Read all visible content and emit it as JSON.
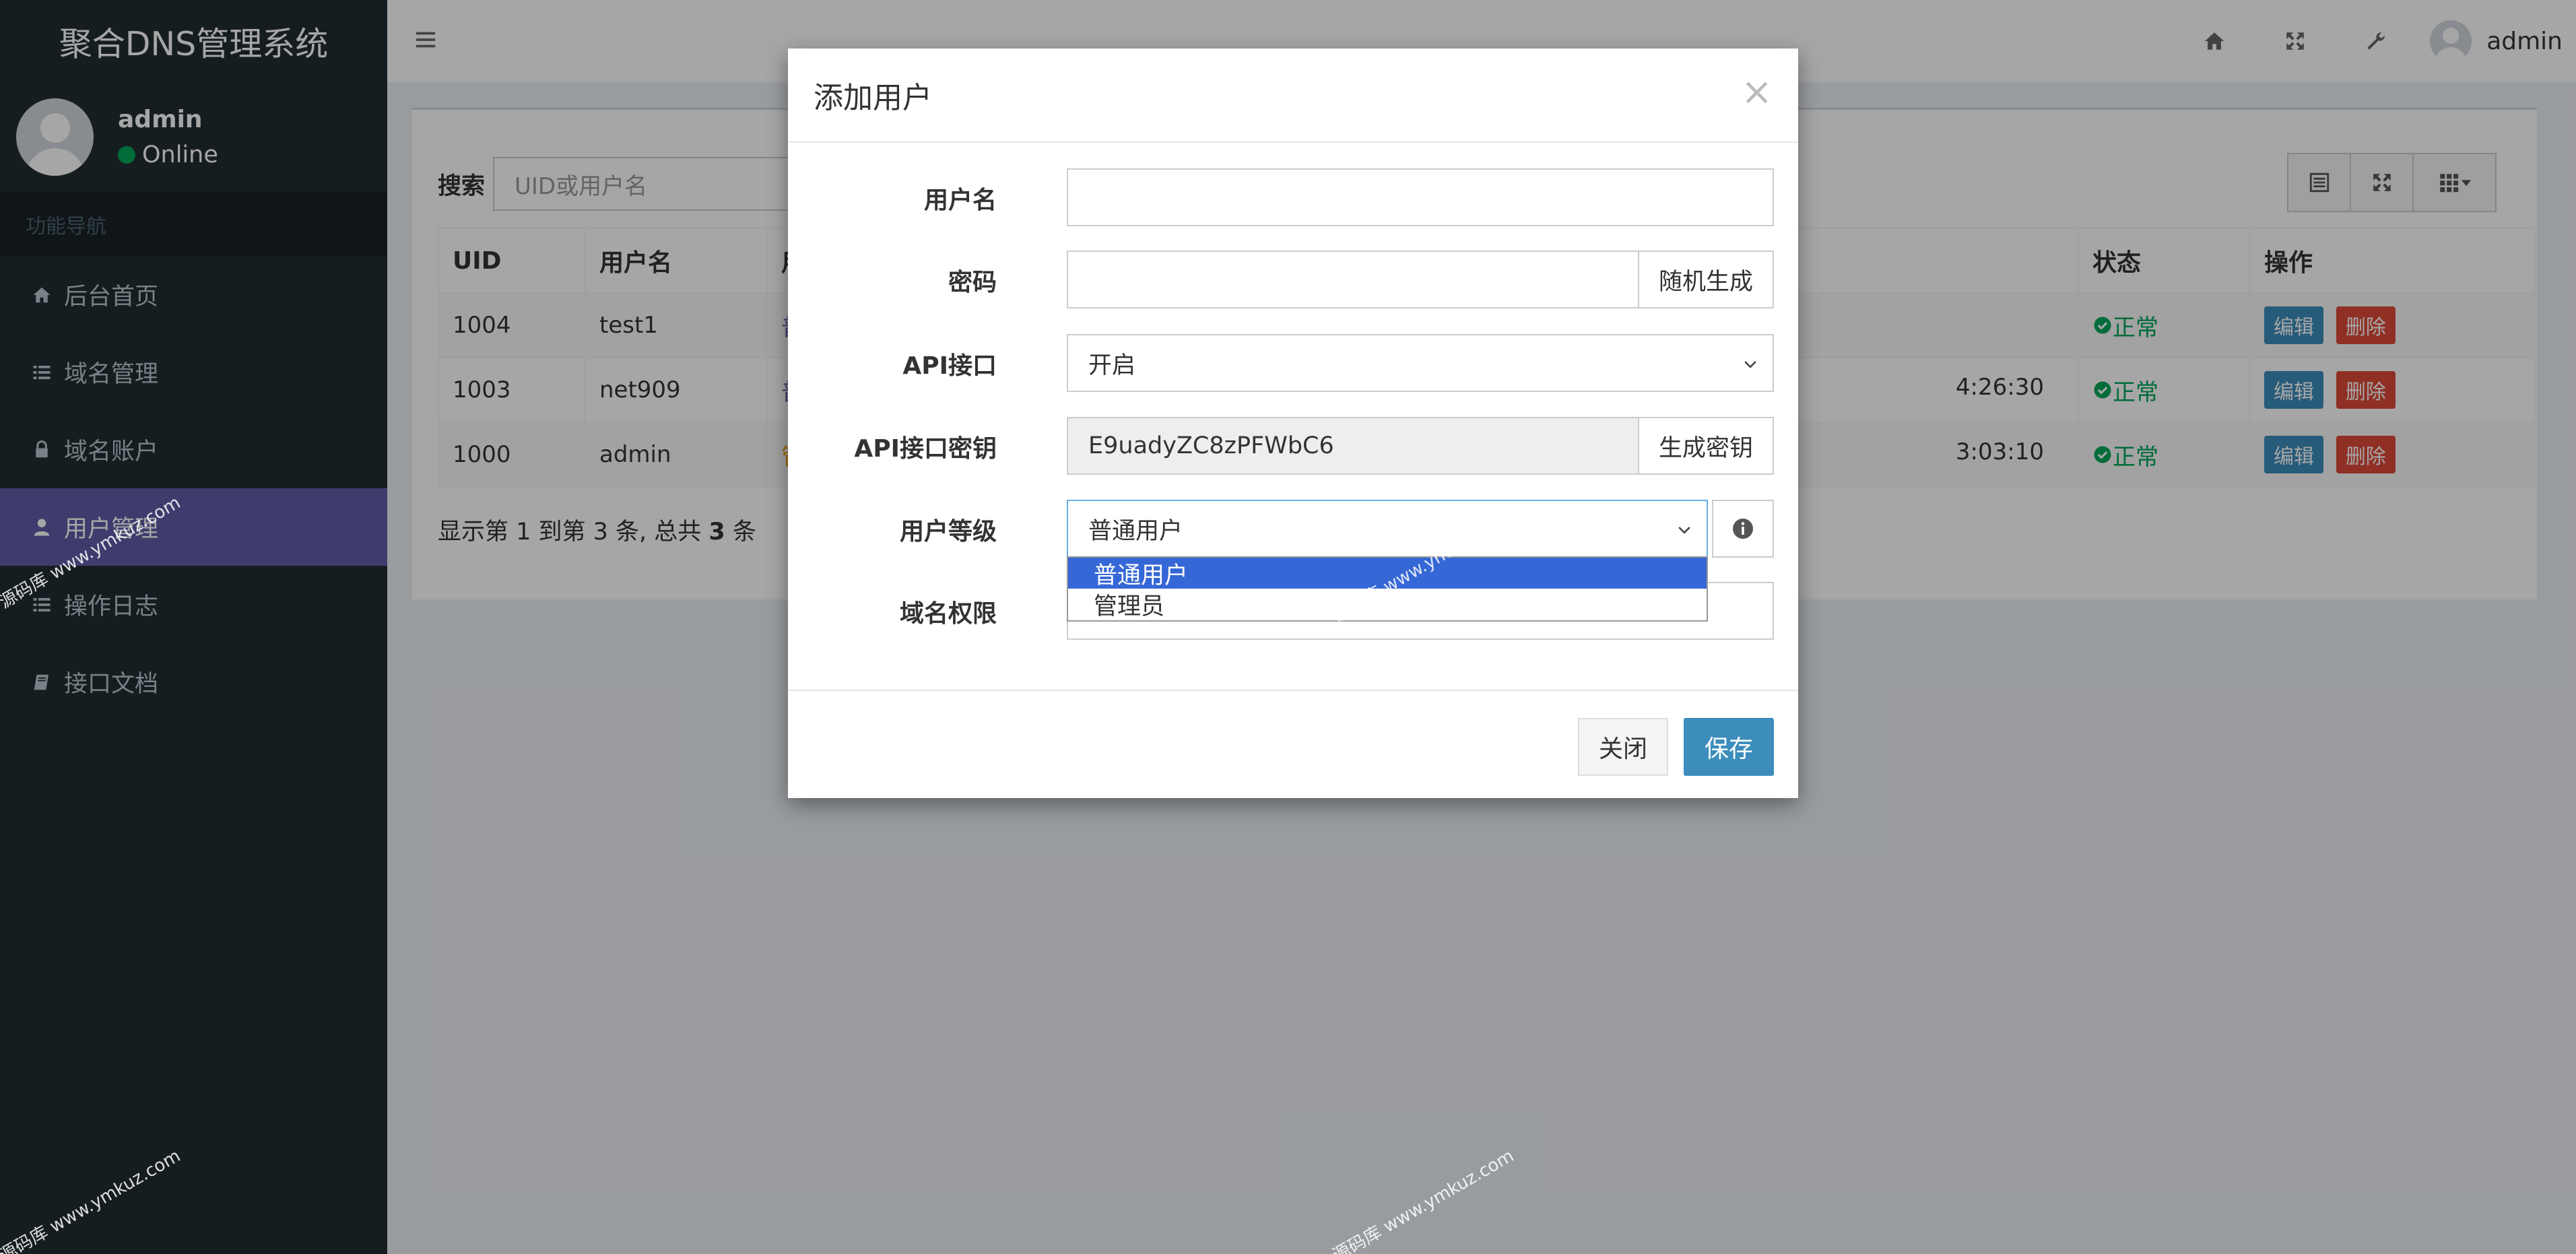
{
  "sidebar": {
    "brand": "聚合DNS管理系统",
    "user_name": "admin",
    "user_status": "Online",
    "nav_header": "功能导航",
    "items": [
      {
        "label": "后台首页",
        "icon": "home-icon"
      },
      {
        "label": "域名管理",
        "icon": "list-icon"
      },
      {
        "label": "域名账户",
        "icon": "lock-icon"
      },
      {
        "label": "用户管理",
        "icon": "user-icon",
        "active": true
      },
      {
        "label": "操作日志",
        "icon": "list-icon"
      },
      {
        "label": "接口文档",
        "icon": "book-icon"
      }
    ]
  },
  "header": {
    "user_name": "admin"
  },
  "main": {
    "search_label": "搜索",
    "search_placeholder": "UID或用户名",
    "columns": [
      "UID",
      "用户名",
      "用",
      "状态",
      "操作"
    ],
    "rows": [
      {
        "uid": "1004",
        "name": "test1",
        "level": "普",
        "time": "",
        "status": "正常"
      },
      {
        "uid": "1003",
        "name": "net909",
        "level": "普",
        "time": "4:26:30",
        "status": "正常"
      },
      {
        "uid": "1000",
        "name": "admin",
        "level": "管",
        "time": "3:03:10",
        "status": "正常"
      }
    ],
    "edit_label": "编辑",
    "delete_label": "删除",
    "pager_prefix": "显示第 1 到第 3 条, 总共 ",
    "pager_total": "3",
    "pager_suffix": " 条"
  },
  "modal": {
    "title": "添加用户",
    "close_symbol": "×",
    "fields": {
      "username_label": "用户名",
      "username_value": "",
      "password_label": "密码",
      "password_value": "",
      "password_addon": "随机生成",
      "api_label": "API接口",
      "api_value": "开启",
      "apikey_label": "API接口密钥",
      "apikey_value": "E9uadyZC8zPFWbC6",
      "apikey_addon": "生成密钥",
      "level_label": "用户等级",
      "level_value": "普通用户",
      "level_options": [
        "普通用户",
        "管理员"
      ],
      "domain_label": "域名权限"
    },
    "close_button": "关闭",
    "save_button": "保存"
  },
  "watermark": "源码库 www.ymkuz.com",
  "colors": {
    "sidebar_bg": "#222d32",
    "active_nav": "#605ca8",
    "status_green": "#00a65a",
    "btn_info": "#3c8dbc",
    "btn_danger": "#dd4b39",
    "dropdown_selected": "#3567d6"
  }
}
